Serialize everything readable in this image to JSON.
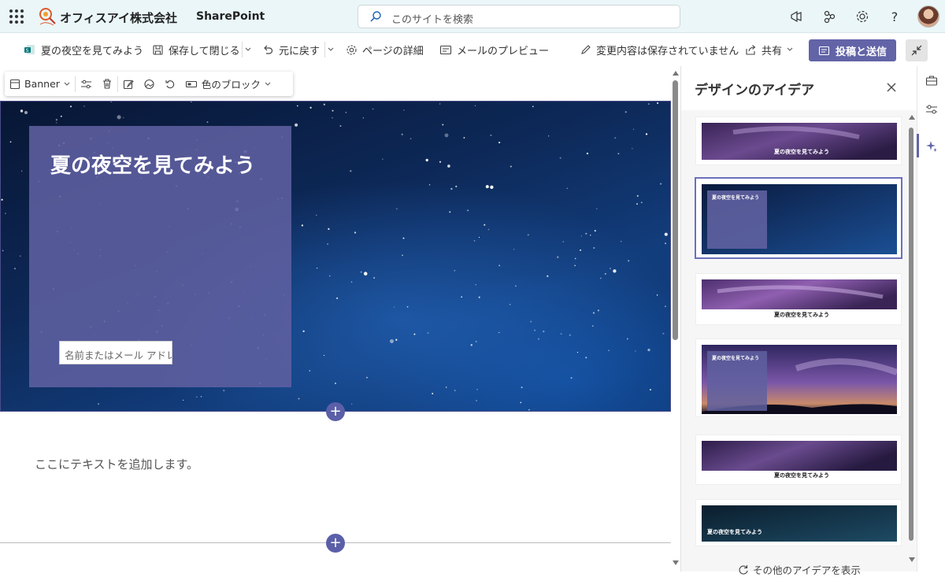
{
  "suite": {
    "site_name": "オフィスアイ株式会社",
    "app_name": "SharePoint",
    "search_placeholder": "このサイトを検索"
  },
  "commands": {
    "page_name": "夏の夜空を見てみよう",
    "save_close": "保存して閉じる",
    "undo": "元に戻す",
    "page_details": "ページの詳細",
    "email_preview": "メールのプレビュー",
    "unsaved_status": "変更内容は保存されていません",
    "share": "共有",
    "post_send": "投稿と送信"
  },
  "webpart_toolbar": {
    "layout": "Banner",
    "color_block": "色のブロック"
  },
  "banner": {
    "title": "夏の夜空を見てみよう",
    "author_placeholder": "名前またはメール アドレ"
  },
  "text_section": {
    "placeholder": "ここにテキストを追加します。"
  },
  "design_panel": {
    "title": "デザインのアイデア",
    "ideas": [
      {
        "caption": "夏の夜空を見てみよう",
        "style": "purple-sky-center",
        "selected": false
      },
      {
        "caption": "夏の夜空を見てみよう",
        "style": "blue-stars-box",
        "selected": true
      },
      {
        "caption": "夏の夜空を見てみよう",
        "style": "purple-sky-below",
        "selected": false
      },
      {
        "caption": "夏の夜空を見てみよう",
        "style": "purple-sunset-box",
        "selected": false
      },
      {
        "caption": "夏の夜空を見てみよう",
        "style": "milkyway-below",
        "selected": false
      },
      {
        "caption": "夏の夜空を見てみよう",
        "style": "teal-stars-left",
        "selected": false
      }
    ],
    "more_ideas": "その他のアイデアを表示"
  },
  "colors": {
    "accent": "#6264a7",
    "title_box": "#5f60a0",
    "suite_bar": "#eaf6f8"
  },
  "icons": [
    "waffle-icon",
    "megaphone-icon",
    "share-network-icon",
    "gear-icon",
    "help-icon",
    "search-icon"
  ]
}
